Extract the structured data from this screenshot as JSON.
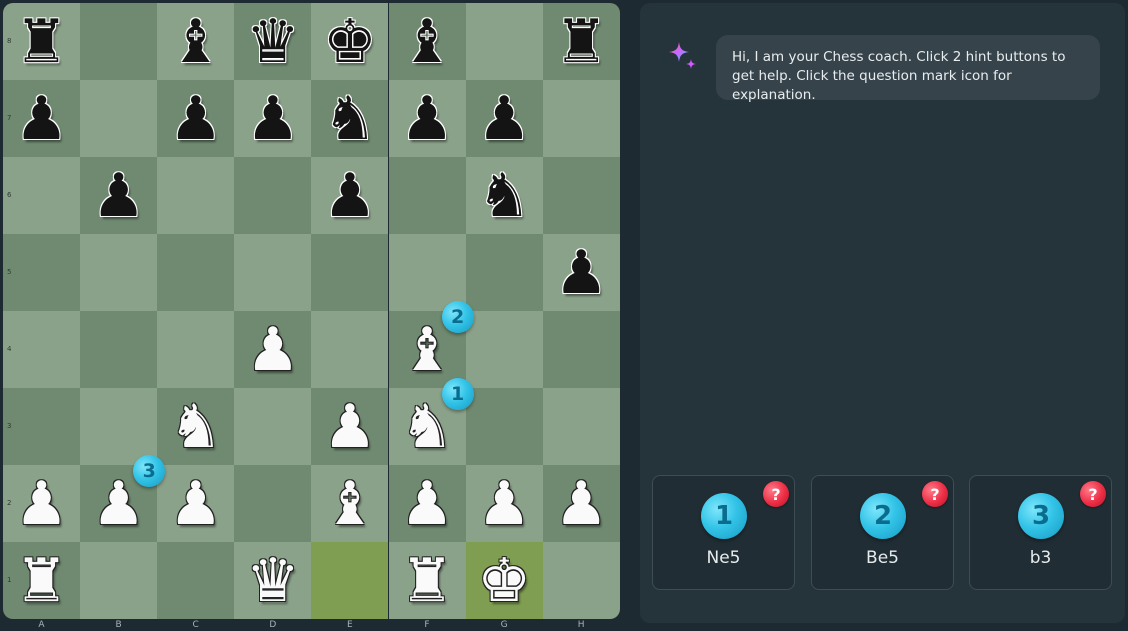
{
  "board": {
    "files": [
      "A",
      "B",
      "C",
      "D",
      "E",
      "F",
      "G",
      "H"
    ],
    "ranks": [
      "8",
      "7",
      "6",
      "5",
      "4",
      "3",
      "2",
      "1"
    ],
    "colors": {
      "light": "#8ba28a",
      "dark": "#6f8a70",
      "highlight": "#7f9e52"
    },
    "highlighted_squares": [
      "e1",
      "g1"
    ],
    "pieces": [
      {
        "square": "a8",
        "color": "black",
        "type": "rook",
        "glyph": "♜"
      },
      {
        "square": "c8",
        "color": "black",
        "type": "bishop",
        "glyph": "♝"
      },
      {
        "square": "d8",
        "color": "black",
        "type": "queen",
        "glyph": "♛"
      },
      {
        "square": "e8",
        "color": "black",
        "type": "king",
        "glyph": "♚"
      },
      {
        "square": "f8",
        "color": "black",
        "type": "bishop",
        "glyph": "♝"
      },
      {
        "square": "h8",
        "color": "black",
        "type": "rook",
        "glyph": "♜"
      },
      {
        "square": "a7",
        "color": "black",
        "type": "pawn",
        "glyph": "♟"
      },
      {
        "square": "c7",
        "color": "black",
        "type": "pawn",
        "glyph": "♟"
      },
      {
        "square": "d7",
        "color": "black",
        "type": "pawn",
        "glyph": "♟"
      },
      {
        "square": "e7",
        "color": "black",
        "type": "knight",
        "glyph": "♞"
      },
      {
        "square": "f7",
        "color": "black",
        "type": "pawn",
        "glyph": "♟"
      },
      {
        "square": "g7",
        "color": "black",
        "type": "pawn",
        "glyph": "♟"
      },
      {
        "square": "b6",
        "color": "black",
        "type": "pawn",
        "glyph": "♟"
      },
      {
        "square": "e6",
        "color": "black",
        "type": "pawn",
        "glyph": "♟"
      },
      {
        "square": "g6",
        "color": "black",
        "type": "knight",
        "glyph": "♞"
      },
      {
        "square": "h5",
        "color": "black",
        "type": "pawn",
        "glyph": "♟"
      },
      {
        "square": "d4",
        "color": "white",
        "type": "pawn",
        "glyph": "♟"
      },
      {
        "square": "f4",
        "color": "white",
        "type": "bishop",
        "glyph": "♝"
      },
      {
        "square": "c3",
        "color": "white",
        "type": "knight",
        "glyph": "♞"
      },
      {
        "square": "e3",
        "color": "white",
        "type": "pawn",
        "glyph": "♟"
      },
      {
        "square": "f3",
        "color": "white",
        "type": "knight",
        "glyph": "♞"
      },
      {
        "square": "a2",
        "color": "white",
        "type": "pawn",
        "glyph": "♟"
      },
      {
        "square": "b2",
        "color": "white",
        "type": "pawn",
        "glyph": "♟"
      },
      {
        "square": "c2",
        "color": "white",
        "type": "pawn",
        "glyph": "♟"
      },
      {
        "square": "e2",
        "color": "white",
        "type": "bishop",
        "glyph": "♝"
      },
      {
        "square": "f2",
        "color": "white",
        "type": "pawn",
        "glyph": "♟"
      },
      {
        "square": "g2",
        "color": "white",
        "type": "pawn",
        "glyph": "♟"
      },
      {
        "square": "h2",
        "color": "white",
        "type": "pawn",
        "glyph": "♟"
      },
      {
        "square": "a1",
        "color": "white",
        "type": "rook",
        "glyph": "♜"
      },
      {
        "square": "d1",
        "color": "white",
        "type": "queen",
        "glyph": "♛"
      },
      {
        "square": "f1",
        "color": "white",
        "type": "rook",
        "glyph": "♜"
      },
      {
        "square": "g1",
        "color": "white",
        "type": "king",
        "glyph": "♚"
      }
    ],
    "markers": [
      {
        "number": "1",
        "square": "f3",
        "corner": "top-right"
      },
      {
        "number": "2",
        "square": "f4",
        "corner": "top-right"
      },
      {
        "number": "3",
        "square": "b2",
        "corner": "top-right"
      }
    ]
  },
  "coach": {
    "icon": "sparkle-icon",
    "message": "Hi, I am your Chess coach. Click 2 hint buttons to get help. Click the question mark icon for explanation."
  },
  "hints": [
    {
      "number": "1",
      "move": "Ne5",
      "help_icon": "question-mark-icon",
      "help_glyph": "?"
    },
    {
      "number": "2",
      "move": "Be5",
      "help_icon": "question-mark-icon",
      "help_glyph": "?"
    },
    {
      "number": "3",
      "move": "b3",
      "help_icon": "question-mark-icon",
      "help_glyph": "?"
    }
  ]
}
